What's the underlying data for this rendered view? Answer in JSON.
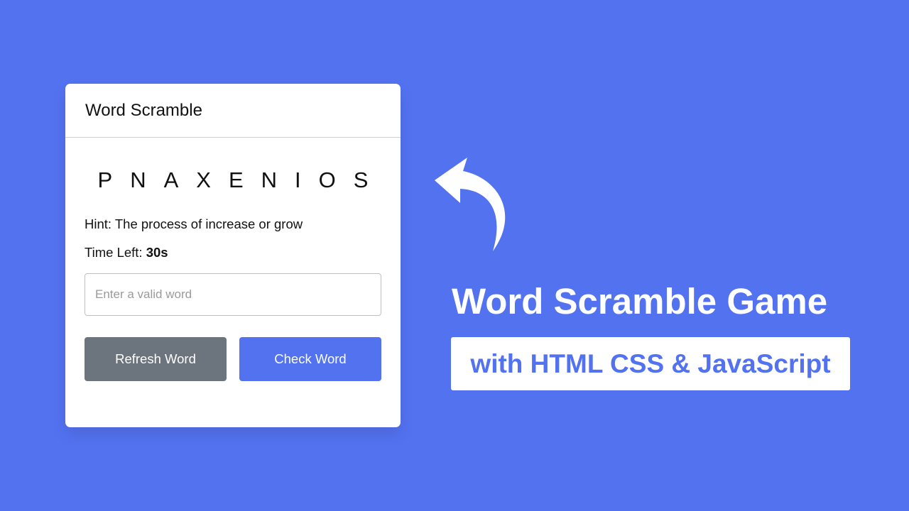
{
  "card": {
    "title": "Word Scramble",
    "scrambled_word": "PNAXENIOS",
    "hint_label": "Hint: ",
    "hint_text": "The process of increase or grow",
    "time_label": "Time Left: ",
    "time_value": "30",
    "time_unit": "s",
    "input": {
      "value": "",
      "placeholder": "Enter a valid word"
    },
    "refresh_label": "Refresh Word",
    "check_label": "Check Word"
  },
  "promo": {
    "title": "Word Scramble Game",
    "subtitle": "with HTML CSS & JavaScript"
  },
  "icons": {
    "arrow": "curved-arrow-icon"
  },
  "colors": {
    "background": "#5372F0",
    "card": "#FFFFFF",
    "refresh_button": "#6C757D",
    "check_button": "#5372F0",
    "subtitle_text": "#5372F0"
  }
}
